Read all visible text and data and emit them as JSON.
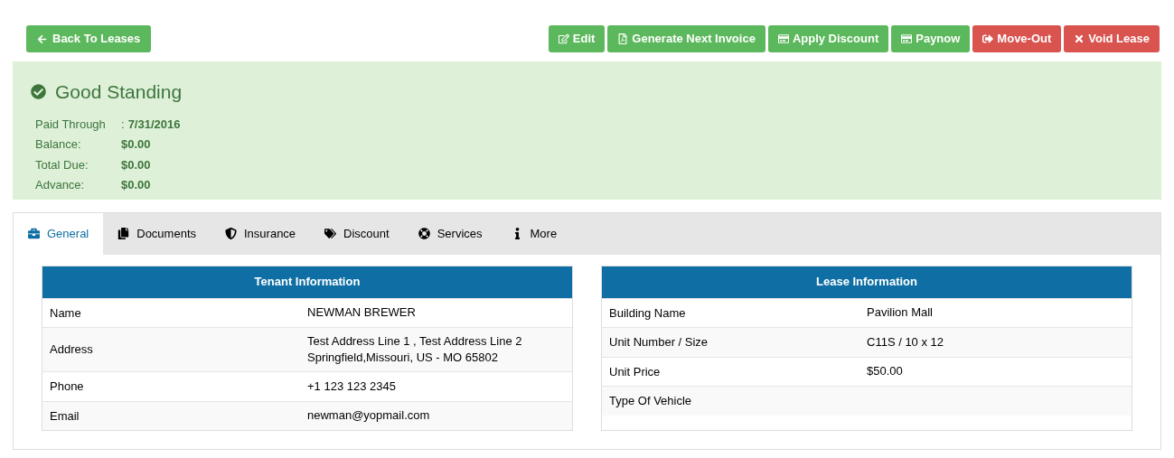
{
  "back_button": {
    "label": "Back To Leases"
  },
  "actions": [
    {
      "label": "Edit",
      "kind": "edit",
      "color": "#5cb85c"
    },
    {
      "label": "Generate Next Invoice",
      "kind": "pdf",
      "color": "#5cb85c"
    },
    {
      "label": "Apply Discount",
      "kind": "card",
      "color": "#5cb85c"
    },
    {
      "label": "Paynow",
      "kind": "card",
      "color": "#5cb85c"
    },
    {
      "label": "Move-Out",
      "kind": "exit",
      "color": "#d9534f"
    },
    {
      "label": "Void Lease",
      "kind": "close",
      "color": "#d9534f"
    }
  ],
  "status": {
    "title": "Good Standing",
    "rows": [
      {
        "label": "Paid Through",
        "separator": ":",
        "value": "7/31/2016"
      },
      {
        "label": "Balance:",
        "value": "$0.00"
      },
      {
        "label": "Total Due:",
        "value": "$0.00"
      },
      {
        "label": "Advance:",
        "value": "$0.00"
      }
    ]
  },
  "tabs": [
    {
      "label": "General",
      "kind": "briefcase",
      "selected": true
    },
    {
      "label": "Documents",
      "kind": "files",
      "selected": false
    },
    {
      "label": "Insurance",
      "kind": "shield",
      "selected": false
    },
    {
      "label": "Discount",
      "kind": "tags",
      "selected": false
    },
    {
      "label": "Services",
      "kind": "lifering",
      "selected": false
    },
    {
      "label": "More",
      "kind": "info",
      "selected": false
    }
  ],
  "tables": [
    {
      "title": "Tenant Information",
      "rows": [
        {
          "label": "Name",
          "value": "NEWMAN BREWER"
        },
        {
          "label": "Address",
          "value": "Test Address Line 1 , Test Address Line 2\nSpringfield,Missouri, US - MO 65802"
        },
        {
          "label": "Phone",
          "value": "+1 123 123 2345"
        },
        {
          "label": "Email",
          "value": "newman@yopmail.com"
        }
      ]
    },
    {
      "title": "Lease Information",
      "rows": [
        {
          "label": "Building Name",
          "value": "Pavilion Mall"
        },
        {
          "label": "Unit Number / Size",
          "value": "C11S / 10 x 12"
        },
        {
          "label": "Unit Price",
          "value": "$50.00"
        },
        {
          "label": "Type Of Vehicle"
        }
      ]
    }
  ]
}
